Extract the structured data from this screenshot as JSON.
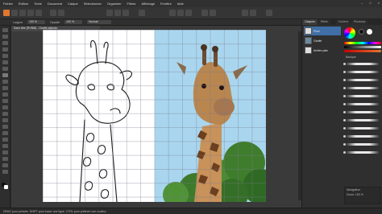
{
  "menu": [
    "Fichier",
    "Édition",
    "Texte",
    "Document",
    "Calque",
    "Sélectionner",
    "Organiser",
    "Filtres",
    "Affichage",
    "Fenêtre",
    "Aide"
  ],
  "context_bar": {
    "zoom_label": "100 %",
    "blend_mode": "Normal",
    "width_label": "Largeur",
    "opacity_label": "Opacité"
  },
  "document_tab": "Sans titre (RVB/8) - Giraffe.afphoto",
  "layers_panel": {
    "tabs": [
      "Calques",
      "Effets"
    ],
    "layers": [
      {
        "name": "Pixel",
        "kind": "sketch",
        "selected": true
      },
      {
        "name": "Giraffe",
        "kind": "photo",
        "selected": false
      },
      {
        "name": "Arrière-plan",
        "kind": "sketch",
        "selected": false
      }
    ]
  },
  "brushes_panel": {
    "tabs": [
      "Couleur",
      "Pinceaux"
    ],
    "category": "Basique"
  },
  "bottom_panel": {
    "label": "Navigateur",
    "zoom": "Zoom: 100 %"
  },
  "status": "DRAG pour peindre. SHIFT pour tracer une ligne. CTRL pour prélever une couleur.",
  "colors": {
    "accent": "#e0772e",
    "selection": "#3f6fa6",
    "sky": "#a9d6ee"
  }
}
